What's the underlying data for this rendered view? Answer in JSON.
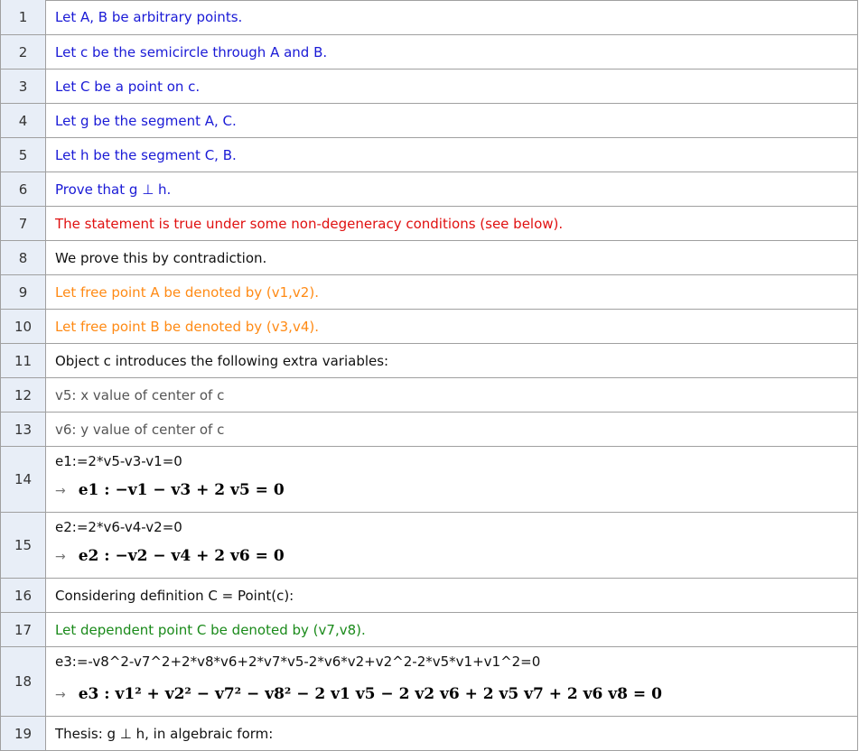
{
  "rows": [
    {
      "n": "1",
      "text": "Let A, B be arbitrary points.",
      "color": "blue"
    },
    {
      "n": "2",
      "text": "Let c be the semicircle through A and B.",
      "color": "blue"
    },
    {
      "n": "3",
      "text": "Let C be a point on c.",
      "color": "blue"
    },
    {
      "n": "4",
      "text": "Let g be the segment A, C.",
      "color": "blue"
    },
    {
      "n": "5",
      "text": "Let h be the segment C, B.",
      "color": "blue"
    },
    {
      "n": "6",
      "text": "Prove that g ⊥ h.",
      "color": "blue"
    },
    {
      "n": "7",
      "text": "The statement is true under some non-degeneracy conditions (see below).",
      "color": "red"
    },
    {
      "n": "8",
      "text": "We prove this by contradiction.",
      "color": "black"
    },
    {
      "n": "9",
      "text": "Let free point A be denoted by (v1,v2).",
      "color": "orange"
    },
    {
      "n": "10",
      "text": "Let free point B be denoted by (v3,v4).",
      "color": "orange"
    },
    {
      "n": "11",
      "text": "Object c introduces the following extra variables:",
      "color": "black"
    },
    {
      "n": "12",
      "text": "v5: x value of center of c",
      "color": "gray"
    },
    {
      "n": "13",
      "text": "v6: y value of center of c",
      "color": "gray"
    },
    {
      "n": "14",
      "text": "e1:=2*v5-v3-v1=0",
      "color": "black",
      "output": "e1 :  −v1 − v3 + 2 v5 = 0"
    },
    {
      "n": "15",
      "text": "e2:=2*v6-v4-v2=0",
      "color": "black",
      "output": "e2 :  −v2 − v4 + 2 v6 = 0"
    },
    {
      "n": "16",
      "text": "Considering definition C = Point(c):",
      "color": "black"
    },
    {
      "n": "17",
      "text": "Let dependent point C be denoted by (v7,v8).",
      "color": "green"
    },
    {
      "n": "18",
      "text": "e3:=-v8^2-v7^2+2*v8*v6+2*v7*v5-2*v6*v2+v2^2-2*v5*v1+v1^2=0",
      "color": "black",
      "output": "e3 :  v1² + v2² − v7² − v8² − 2 v1 v5 − 2 v2 v6 + 2 v5 v7 + 2 v6 v8 = 0"
    },
    {
      "n": "19",
      "text": "Thesis: g ⊥ h, in algebraic form:",
      "color": "black"
    }
  ],
  "arrow_symbol": "→"
}
